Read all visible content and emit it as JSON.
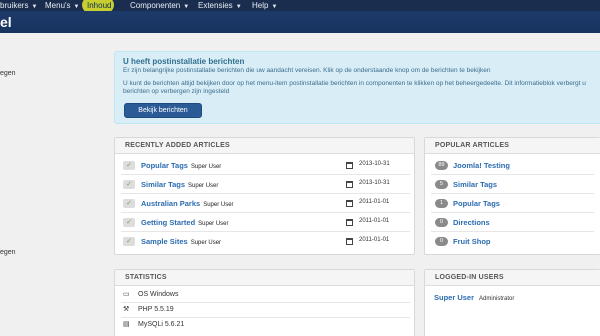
{
  "topnav": {
    "items": [
      {
        "label": "bruikers"
      },
      {
        "label": "Menu's"
      },
      {
        "label": "Inhoud"
      },
      {
        "label": "Componenten"
      },
      {
        "label": "Extensies"
      },
      {
        "label": "Help"
      }
    ]
  },
  "header": {
    "title": "el"
  },
  "sidebar": {
    "items": [
      "egen",
      "egen"
    ]
  },
  "alert": {
    "heading": "U heeft postinstallatie berichten",
    "line1": "Er zijn belangrijke postinstallatie berichten die uw aandacht vereisen. Klik op de onderstaande knop om de berichten te bekijken",
    "line2": "U kunt de berichten altijd bekijken door op het menu-item postinstallatie berichten in componenten te klikken op het beheergedeelte. Dit informatieblok verbergt u",
    "line3": "berichten op verbergen zijn ingesteld",
    "button": "Bekijk berichten"
  },
  "recent": {
    "title": "RECENTLY ADDED ARTICLES",
    "rows": [
      {
        "title": "Popular Tags",
        "author": "Super User",
        "date": "2013-10-31"
      },
      {
        "title": "Similar Tags",
        "author": "Super User",
        "date": "2013-10-31"
      },
      {
        "title": "Australian Parks",
        "author": "Super User",
        "date": "2011-01-01"
      },
      {
        "title": "Getting Started",
        "author": "Super User",
        "date": "2011-01-01"
      },
      {
        "title": "Sample Sites",
        "author": "Super User",
        "date": "2011-01-01"
      }
    ]
  },
  "popular": {
    "title": "POPULAR ARTICLES",
    "rows": [
      {
        "hits": "89",
        "title": "Joomla! Testing"
      },
      {
        "hits": "5",
        "title": "Similar Tags"
      },
      {
        "hits": "1",
        "title": "Popular Tags"
      },
      {
        "hits": "0",
        "title": "Directions"
      },
      {
        "hits": "0",
        "title": "Fruit Shop"
      }
    ]
  },
  "stats": {
    "title": "STATISTICS",
    "rows": [
      {
        "icon": "monitor-icon",
        "text": "OS Windows"
      },
      {
        "icon": "wrench-icon",
        "text": "PHP 5.5.19"
      },
      {
        "icon": "database-icon",
        "text": "MySQLi 5.6.21"
      }
    ]
  },
  "logged": {
    "title": "LOGGED-IN USERS",
    "user": "Super User",
    "role": "Administrator"
  },
  "colors": {
    "nav": "#1a2d4f",
    "header": "#17335f",
    "link": "#2c6cb0",
    "alert": "#d9edf7",
    "highlight": "#e8eb28"
  }
}
